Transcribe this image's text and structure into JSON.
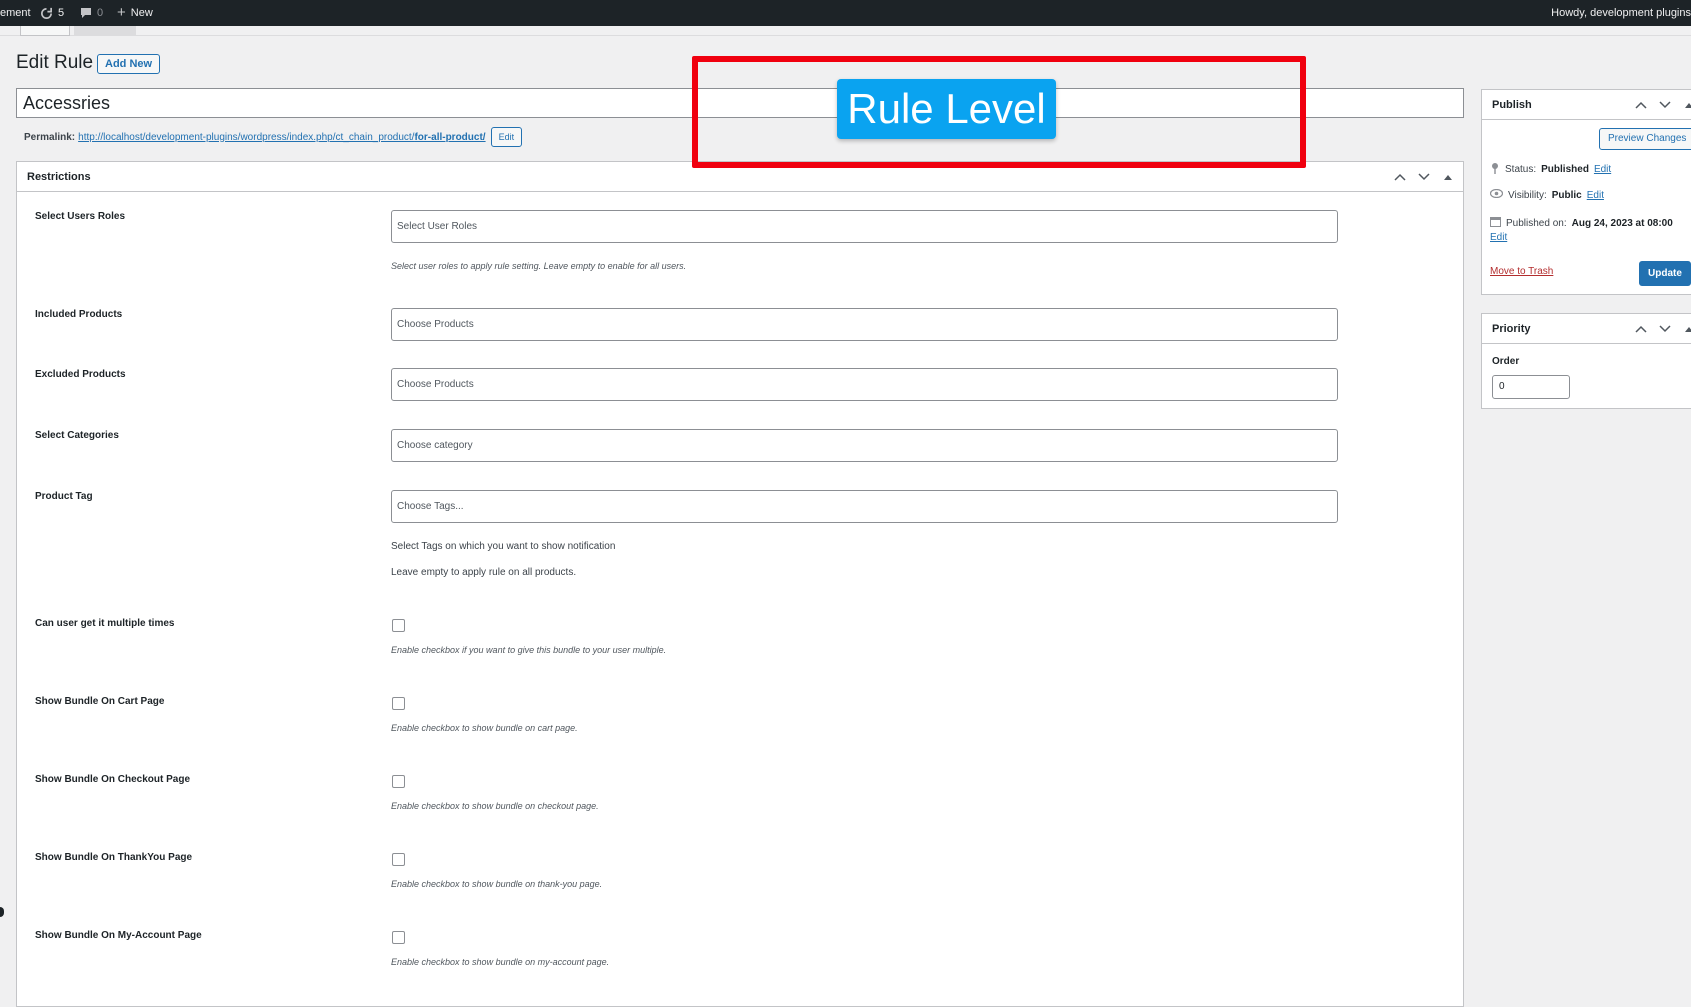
{
  "adminbar": {
    "site_fragment": "ement",
    "updates_count": "5",
    "comments_count": "0",
    "new_label": "New",
    "howdy": "Howdy, development plugins"
  },
  "page": {
    "title": "Edit Rule",
    "add_new": "Add New",
    "post_title": "Accessries",
    "permalink_label": "Permalink:",
    "permalink_base": "http://localhost/development-plugins/wordpress/index.php/ct_chain_product/",
    "permalink_slug": "for-all-product/",
    "permalink_edit": "Edit"
  },
  "restrictions": {
    "title": "Restrictions",
    "user_roles": {
      "label": "Select Users Roles",
      "placeholder": "Select User Roles",
      "desc": "Select user roles to apply rule setting. Leave empty to enable for all users."
    },
    "included_products": {
      "label": "Included Products",
      "placeholder": "Choose Products"
    },
    "excluded_products": {
      "label": "Excluded Products",
      "placeholder": "Choose Products"
    },
    "categories": {
      "label": "Select Categories",
      "placeholder": "Choose category"
    },
    "product_tag": {
      "label": "Product Tag",
      "placeholder": "Choose Tags...",
      "desc1": "Select Tags on which you want to show notification",
      "desc2": "Leave empty to apply rule on all products."
    },
    "multiple": {
      "label": "Can user get it multiple times",
      "desc": "Enable checkbox if you want to give this bundle to your user multiple."
    },
    "cart": {
      "label": "Show Bundle On Cart Page",
      "desc": "Enable checkbox to show bundle on cart page."
    },
    "checkout": {
      "label": "Show Bundle On Checkout Page",
      "desc": "Enable checkbox to show bundle on checkout page."
    },
    "thankyou": {
      "label": "Show Bundle On ThankYou Page",
      "desc": "Enable checkbox to show bundle on thank-you page."
    },
    "myaccount": {
      "label": "Show Bundle On My-Account Page",
      "desc": "Enable checkbox to show bundle on my-account page."
    }
  },
  "publish": {
    "title": "Publish",
    "preview": "Preview Changes",
    "status_label": "Status:",
    "status_value": "Published",
    "visibility_label": "Visibility:",
    "visibility_value": "Public",
    "published_label": "Published on:",
    "published_value": "Aug 24, 2023 at 08:00",
    "edit": "Edit",
    "trash": "Move to Trash",
    "update": "Update"
  },
  "priority": {
    "title": "Priority",
    "order_label": "Order",
    "order_value": "0"
  },
  "overlay": {
    "label": "Rule Level",
    "border_color": "#f0000f",
    "badge_color": "#0aa3f0"
  },
  "colors": {
    "accent": "#2271b1",
    "adminbar": "#1d2327",
    "danger": "#b32d2e"
  }
}
